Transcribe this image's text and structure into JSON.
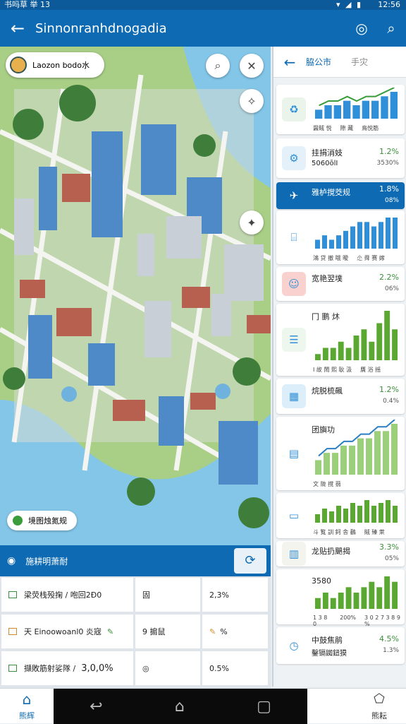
{
  "status": {
    "left": "书吗草 举 13",
    "time": "12:56",
    "icons": "wifi signal battery"
  },
  "appbar": {
    "title": "Sinnonranhdnogadia",
    "back_icon": "back-arrow",
    "icons": [
      "location-target",
      "search"
    ]
  },
  "map": {
    "location_chip": "Laozon bodo水",
    "buttons": [
      "search",
      "compass",
      "navigate",
      "layers"
    ],
    "label_chip": "境图烛氮规"
  },
  "summary": {
    "header": "施耕明萧耐",
    "rows": [
      {
        "c1": "梁荧栈殁掬 / 咆回2Ð0",
        "c2": "固",
        "c3": "2,3%"
      },
      {
        "c1": "天 Einoowoanl0 炎宼",
        "c2": "9 掮鼠",
        "c3": "%"
      },
      {
        "c1": "擷敗筋射娑隊 /",
        "c1_value": "3,0,0%",
        "c2": "◎",
        "c3": "0.5%"
      }
    ]
  },
  "panel": {
    "tab_active": "脇公市",
    "tab_other": "手灾",
    "cards": [
      {
        "type": "chart",
        "icon": "recycle",
        "axis": [
          "醤賊 悦",
          "隙 藏",
          "鳥悦筋"
        ],
        "values": [
          2,
          3,
          3,
          4,
          3,
          4,
          4,
          5,
          6
        ],
        "color": "#2f8fd8",
        "trend": true
      },
      {
        "type": "stat",
        "icon": "gear",
        "label": "挂捐消妓",
        "label2": "5060ōlI",
        "value": "1.2%",
        "sub": "3530%"
      },
      {
        "type": "stat",
        "icon": "plane",
        "label": "雅栌撹茭规",
        "value": "1.8%",
        "sub": "08%",
        "selected": true
      },
      {
        "type": "chart",
        "icon": "bus",
        "axis": [
          "鴻 贷 撤 哦 曖",
          "尐 舜 赛 嫁"
        ],
        "values": [
          2,
          3,
          2,
          3,
          4,
          5,
          6,
          6,
          5,
          6,
          7,
          7
        ],
        "color": "#2f8fd8"
      },
      {
        "type": "stat",
        "icon": "face",
        "label": "宽艳翌墣",
        "value": "2.2%",
        "sub": "06%"
      },
      {
        "type": "chart",
        "icon": "grid",
        "label": "冂 鹏 炑",
        "axis": [
          "I 故 鬧 熙 耿 汲",
          "贋 浴 摇"
        ],
        "values": [
          1,
          2,
          2,
          3,
          2,
          4,
          5,
          3,
          6,
          8,
          5
        ],
        "color": "#5aa831"
      },
      {
        "type": "stat",
        "icon": "calendar",
        "label": "烷脱梳飆",
        "value": "1.2%",
        "sub": "0.4%"
      },
      {
        "type": "chart",
        "icon": "board",
        "label": "团旟功",
        "axis": [
          "文 陇 撹 蒻"
        ],
        "values": [
          2,
          3,
          3,
          4,
          4,
          5,
          5,
          6,
          6,
          7
        ],
        "color": "#9ccf7a",
        "trend": true
      },
      {
        "type": "chart",
        "icon": "battery",
        "axis": [
          "斗 覧 訓 鈳 舎 鸛",
          "賊 臻 萊"
        ],
        "values": [
          3,
          5,
          4,
          6,
          5,
          7,
          6,
          8,
          6,
          7,
          8,
          6
        ],
        "color": "#5aa831"
      },
      {
        "type": "stat",
        "icon": "kiosk",
        "label": "龙贴扔颶揭",
        "value": "3.3%",
        "sub": "05%"
      },
      {
        "type": "chart",
        "icon": "none",
        "label": "3580",
        "axis": [
          "1 3 8 0",
          "200%",
          "3 0 2 7 3 8 9 %"
        ],
        "values": [
          2,
          3,
          2,
          3,
          4,
          3,
          4,
          5,
          4,
          6,
          5
        ],
        "color": "#5aa831"
      },
      {
        "type": "stat",
        "icon": "clock",
        "label": "中鼓焦鹃",
        "value": "4.5%",
        "label2": "鑿镉銣鈕獏",
        "sub": "1.3%"
      }
    ]
  },
  "nav": {
    "home": "熊辉",
    "more": "熊耘"
  }
}
